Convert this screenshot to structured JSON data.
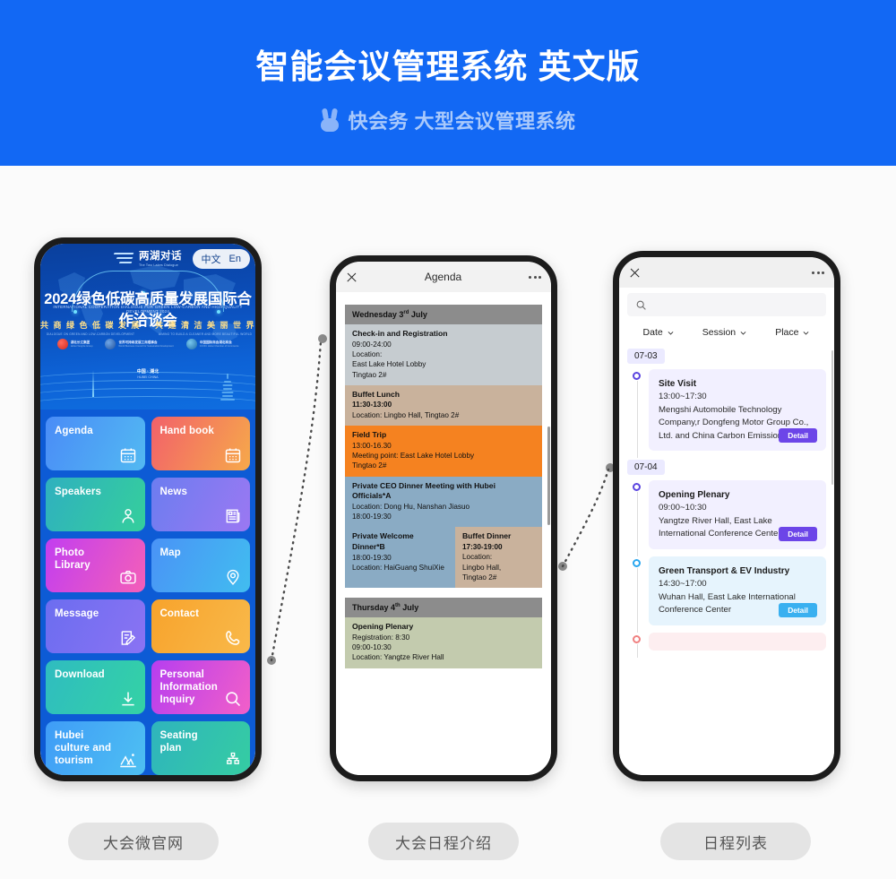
{
  "header": {
    "title": "智能会议管理系统 英文版",
    "brand_icon": "rabbit-icon",
    "subtitle": "快会务 大型会议管理系统",
    "bg_color": "#1268f4"
  },
  "phone1": {
    "banner": {
      "logo_cn": "两湖对话",
      "logo_en": "The Two Lakes Dialogue",
      "lang_cn": "中文",
      "lang_en": "En",
      "title_cn": "2024绿色低碳高质量发展国际合作洽谈会",
      "title_en": "INTERNATIONAL COOPERATION DIALOGUE FOR GREEN LOW-CARBON AND HIGH-QUALITY DEVELOPMENT 2024",
      "slogan1_cn": "共 商 绿 色 低 碳 发 展",
      "slogan1_en": "DIALOGUE ON GREEN AND LOW-CARBON DEVELOPMENT",
      "slogan2_cn": "共 建 清 洁 美 丽 世 界",
      "slogan2_en": "AIMING TO BUILD A CLEANER AND MORE BEAUTIFUL WORLD",
      "orgs": [
        {
          "cn": "湖北长江集团",
          "en": "Hubei Yangtze Group",
          "color": "red"
        },
        {
          "cn": "世界可持续发展工商理事会",
          "en": "World Business Council for Sustainable Development",
          "color": "blu"
        },
        {
          "cn": "中国国际商会湖北商会",
          "en": "CCOIC Hubei Chamber of Commerce",
          "color": "cy"
        }
      ],
      "place_cn": "中国 · 湖北",
      "place_en": "HUBEI CHINA"
    },
    "tiles": [
      {
        "label": "Agenda",
        "icon": "calendar-icon",
        "theme": "t-agenda"
      },
      {
        "label": "Hand book",
        "icon": "calendar-icon",
        "theme": "t-handbook"
      },
      {
        "label": "Speakers",
        "icon": "speaker-person-icon",
        "theme": "t-speakers"
      },
      {
        "label": "News",
        "icon": "newspaper-icon",
        "theme": "t-news"
      },
      {
        "label": "Photo Library",
        "icon": "camera-icon",
        "theme": "t-photo"
      },
      {
        "label": "Map",
        "icon": "location-pin-icon",
        "theme": "t-map"
      },
      {
        "label": "Message",
        "icon": "edit-note-icon",
        "theme": "t-message"
      },
      {
        "label": "Contact",
        "icon": "phone-icon",
        "theme": "t-contact"
      },
      {
        "label": "Download",
        "icon": "download-icon",
        "theme": "t-download"
      },
      {
        "label": "Personal Information Inquiry",
        "icon": "search-icon",
        "theme": "t-personal"
      },
      {
        "label": "Hubei culture and tourism",
        "icon": "landscape-icon",
        "theme": "t-hubei"
      },
      {
        "label": "Seating plan",
        "icon": "seating-chart-icon",
        "theme": "t-seating"
      }
    ]
  },
  "phone2": {
    "nav": {
      "close_icon": "close-icon",
      "title": "Agenda",
      "more_icon": "more-dots-icon"
    },
    "day1": {
      "heading": "Wednesday 3",
      "heading_sup": "rd",
      "heading_tail": " July",
      "rows": [
        {
          "theme": "ag-grey",
          "title": "Check-in and Registration",
          "lines": [
            "09:00-24:00",
            "Location:",
            "East Lake Hotel Lobby",
            "Tingtao 2#"
          ],
          "bold_lines": []
        },
        {
          "theme": "ag-tan",
          "title": "Buffet Lunch",
          "lines": [
            "11:30-13:00",
            "Location: Lingbo Hall, Tingtao 2#"
          ],
          "bold_lines": [
            0
          ]
        },
        {
          "theme": "ag-orange",
          "title": "Field Trip",
          "lines": [
            "13:00-16.30",
            "Meeting point: East Lake Hotel Lobby",
            "Tingtao 2#"
          ],
          "bold_lines": []
        },
        {
          "theme": "ag-blue",
          "title": "Private CEO Dinner Meeting with Hubei Officials*A",
          "lines": [
            "Location: Dong Hu, Nanshan Jiasuo",
            "18:00-19:30"
          ],
          "bold_lines": []
        }
      ],
      "split": {
        "left": {
          "title": "Private Welcome Dinner*B",
          "lines": [
            "18:00-19:30",
            "Location: HaiGuang ShuiXie"
          ],
          "bold_lines": []
        },
        "right": {
          "title": "Buffet Dinner",
          "lines": [
            "17:30-19:00",
            "Location:",
            "Lingbo Hall,",
            "Tingtao 2#"
          ],
          "bold_lines": [
            0
          ]
        }
      }
    },
    "day2": {
      "heading": "Thursday 4",
      "heading_sup": "th",
      "heading_tail": " July",
      "rows": [
        {
          "theme": "ag-green",
          "title": "Opening Plenary",
          "lines": [
            "Registration: 8:30",
            "09:00-10:30",
            "Location: Yangtze River Hall"
          ],
          "bold_lines": []
        }
      ]
    }
  },
  "phone3": {
    "nav": {
      "close_icon": "close-icon",
      "more_icon": "more-dots-icon"
    },
    "search": {
      "icon": "search-icon",
      "placeholder": ""
    },
    "filters": [
      {
        "label": "Date",
        "icon": "chevron-down-icon"
      },
      {
        "label": "Session",
        "icon": "chevron-down-icon"
      },
      {
        "label": "Place",
        "icon": "chevron-down-icon"
      }
    ],
    "groups": [
      {
        "date": "07-03",
        "items": [
          {
            "state": "pending",
            "title": "Site Visit",
            "time": "13:00~17:30",
            "place": "Mengshi Automobile Technology Company,r Dongfeng Motor Group Co., Ltd. and China Carbon Emissions Re",
            "button": "Detail"
          }
        ]
      },
      {
        "date": "07-04",
        "items": [
          {
            "state": "pending",
            "title": "Opening Plenary",
            "time": "09:00~10:30",
            "place": "Yangtze River Hall, East Lake International Conference Center",
            "button": "Detail"
          },
          {
            "state": "live",
            "title": "Green Transport & EV Industry",
            "time": "14:30~17:00",
            "place": "Wuhan Hall, East Lake International Conference Center",
            "button": "Detail"
          },
          {
            "state": "done",
            "title": "",
            "time": "",
            "place": "",
            "button": ""
          }
        ]
      }
    ]
  },
  "captions": [
    {
      "label": "大会微官网"
    },
    {
      "label": "大会日程介绍"
    },
    {
      "label": "日程列表"
    }
  ]
}
